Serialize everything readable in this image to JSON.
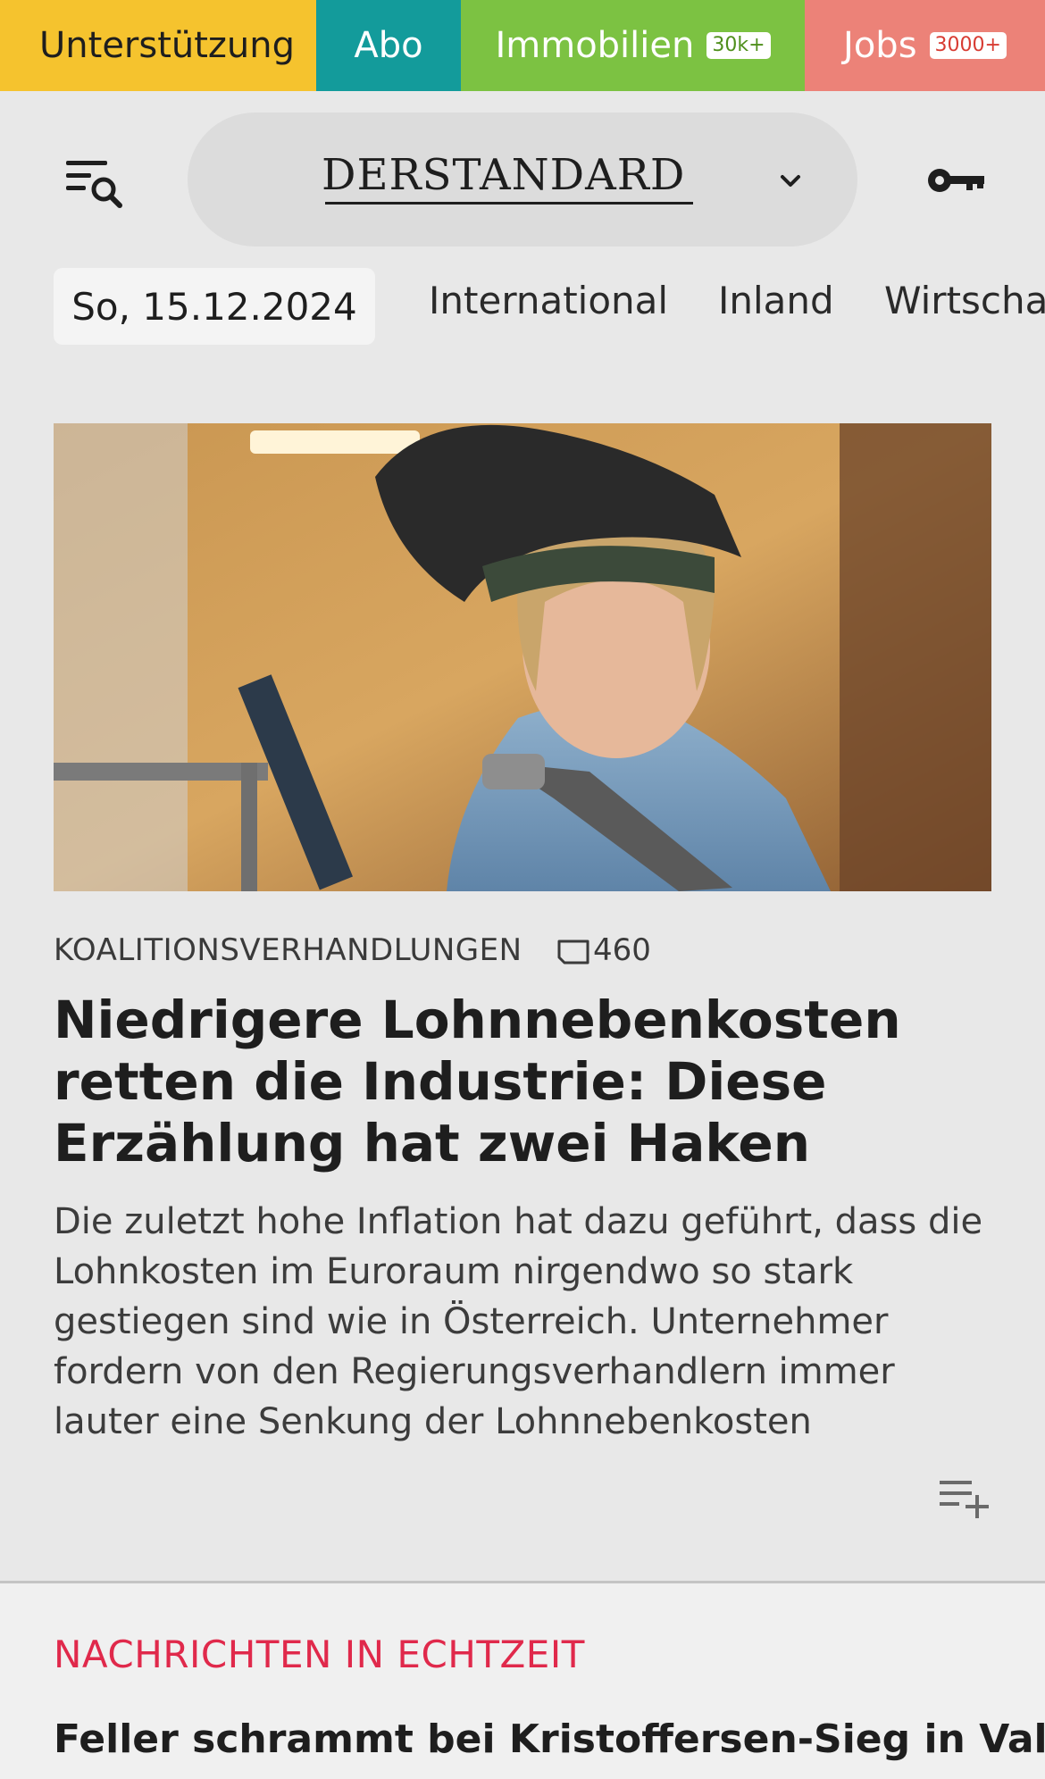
{
  "topbar": {
    "support": "Unterstützung",
    "abo": "Abo",
    "immobilien": "Immobilien",
    "immobilien_badge": "30k+",
    "jobs": "Jobs",
    "jobs_badge": "3000+",
    "colors": {
      "support": "#f5c32e",
      "abo": "#139b9b",
      "immobilien": "#7cc242",
      "jobs": "#ec8278"
    }
  },
  "header": {
    "logo": "DERSTANDARD",
    "menu_icon": "menu-search-icon",
    "dropdown_icon": "chevron-down-icon",
    "login_icon": "key-icon"
  },
  "nav": {
    "date": "So, 15.12.2024",
    "items": [
      "International",
      "Inland",
      "Wirtscha"
    ]
  },
  "article": {
    "image_icon": "photo-welder",
    "kicker": "KOALITIONSVERHANDLUNGEN",
    "comment_count": "460",
    "headline": "Niedrigere Lohnnebenkosten retten die Industrie: Diese Erzählung hat zwei Haken",
    "teaser": "Die zuletzt hohe Inflation hat dazu geführt, dass die Lohnkosten im Euroraum nirgendwo so stark gestiegen sind wie in Österreich. Unternehmer fordern von den Regierungsverhandlern immer lauter eine Senkung der Lohnnebenkosten",
    "playlist_icon": "playlist-add-icon"
  },
  "live": {
    "label": "NACHRICHTEN IN ECHTZEIT",
    "first_headline": "Feller schrammt bei Kristoffersen-Sieg in Val",
    "accent": "#e0294b"
  }
}
